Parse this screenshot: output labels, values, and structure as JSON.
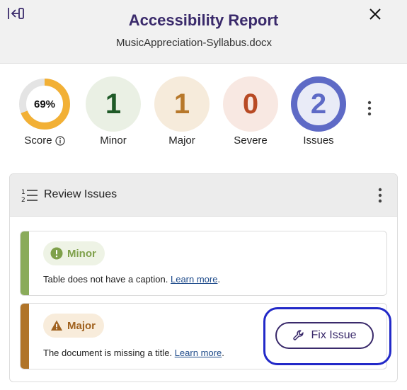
{
  "header": {
    "title": "Accessibility Report",
    "filename": "MusicAppreciation-Syllabus.docx",
    "collapse_icon": "collapse-panel-icon",
    "close_icon": "close-icon"
  },
  "score": {
    "value": "69%",
    "fraction": 0.69,
    "label": "Score",
    "color": "#f2b035",
    "track_color": "#e4e4e4"
  },
  "stats": [
    {
      "count": "1",
      "label": "Minor",
      "bg": "#eaf0e4",
      "fg": "#1f5a27"
    },
    {
      "count": "1",
      "label": "Major",
      "bg": "#f6ebdb",
      "fg": "#b7782b"
    },
    {
      "count": "0",
      "label": "Severe",
      "bg": "#f8e8e2",
      "fg": "#b84a24"
    },
    {
      "count": "2",
      "label": "Issues",
      "bg": "#e9ebf7",
      "fg": "#5e6ac6",
      "ring": "#5e6ac6"
    }
  ],
  "panel": {
    "title": "Review Issues"
  },
  "issues": [
    {
      "severity": "Minor",
      "text": "Table does not have a caption.",
      "link": "Learn more",
      "bar": "#8aab5a",
      "badge_bg": "#eef3e5",
      "badge_fg": "#7ea04a"
    },
    {
      "severity": "Major",
      "text": "The document is missing a title.",
      "link": "Learn more",
      "bar": "#b07428",
      "badge_bg": "#f8ecdb",
      "badge_fg": "#a0621f",
      "action": "Fix Issue"
    }
  ]
}
